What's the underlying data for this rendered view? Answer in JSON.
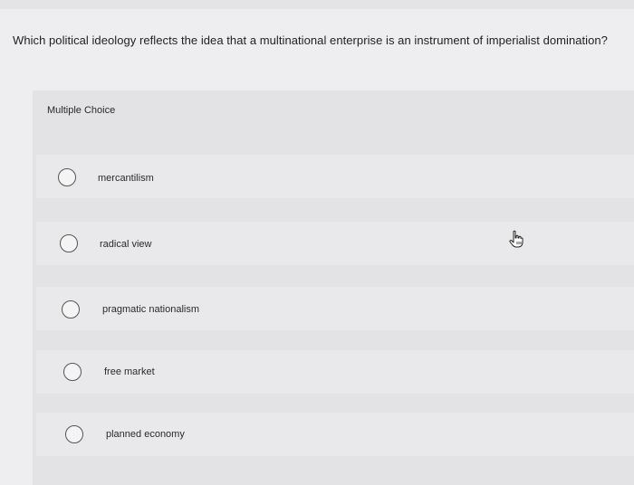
{
  "question": {
    "text": "Which political ideology reflects the idea that a multinational enterprise is an instrument of imperialist domination?"
  },
  "answer_type": "Multiple Choice",
  "choices": [
    {
      "label": "mercantilism",
      "selected": false
    },
    {
      "label": "radical view",
      "selected": false
    },
    {
      "label": "pragmatic nationalism",
      "selected": false
    },
    {
      "label": "free market",
      "selected": false
    },
    {
      "label": "planned economy",
      "selected": false
    }
  ],
  "icons": {
    "radio": "radio-unselected-icon",
    "pointer": "hand-pointer-icon"
  },
  "colors": {
    "background": "#eeeef0",
    "panel": "#e3e3e5",
    "choice_band": "#e9e9eb",
    "radio_border": "#555555",
    "text": "#222222"
  }
}
